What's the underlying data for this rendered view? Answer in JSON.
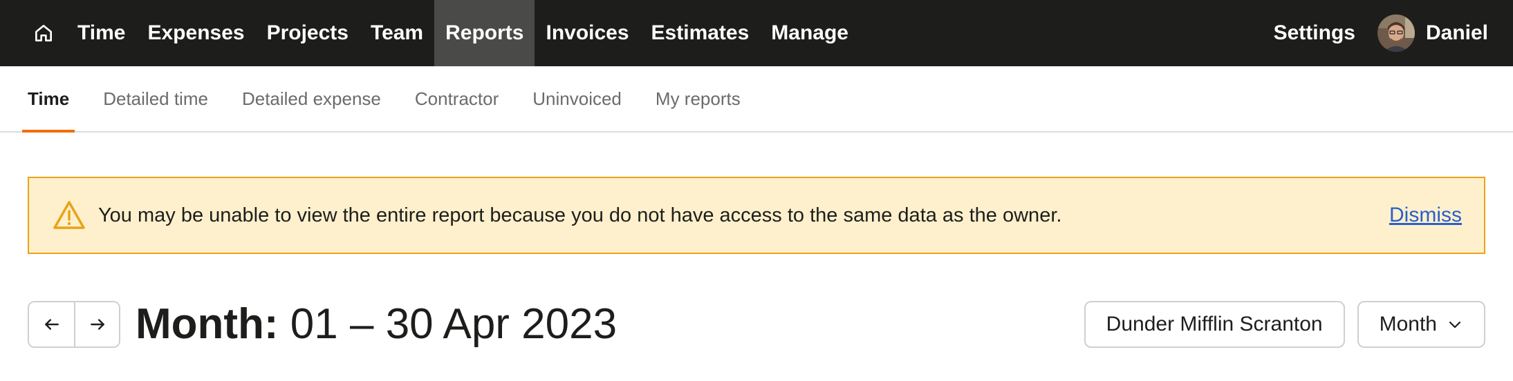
{
  "nav": {
    "items": [
      {
        "label": "Time",
        "active": false
      },
      {
        "label": "Expenses",
        "active": false
      },
      {
        "label": "Projects",
        "active": false
      },
      {
        "label": "Team",
        "active": false
      },
      {
        "label": "Reports",
        "active": true
      },
      {
        "label": "Invoices",
        "active": false
      },
      {
        "label": "Estimates",
        "active": false
      },
      {
        "label": "Manage",
        "active": false
      }
    ],
    "settings": "Settings",
    "user_name": "Daniel",
    "home_icon": "home-icon"
  },
  "subtabs": [
    {
      "label": "Time",
      "active": true
    },
    {
      "label": "Detailed time",
      "active": false
    },
    {
      "label": "Detailed expense",
      "active": false
    },
    {
      "label": "Contractor",
      "active": false
    },
    {
      "label": "Uninvoiced",
      "active": false
    },
    {
      "label": "My reports",
      "active": false
    }
  ],
  "banner": {
    "icon": "warning-icon",
    "message": "You may be unable to view the entire report because you do not have access to the same data as the owner.",
    "dismiss": "Dismiss"
  },
  "period": {
    "label": "Month:",
    "range": "01 – 30 Apr 2023",
    "prev_icon": "arrow-left-icon",
    "next_icon": "arrow-right-icon"
  },
  "filters": {
    "client": "Dunder Mifflin Scranton",
    "timeframe": "Month"
  },
  "colors": {
    "topbar": "#1d1e1c",
    "active_nav": "#4a4a48",
    "accent": "#f36c00",
    "banner_bg": "#fef0cc",
    "banner_border": "#e8a317",
    "link": "#2a5ecc"
  }
}
